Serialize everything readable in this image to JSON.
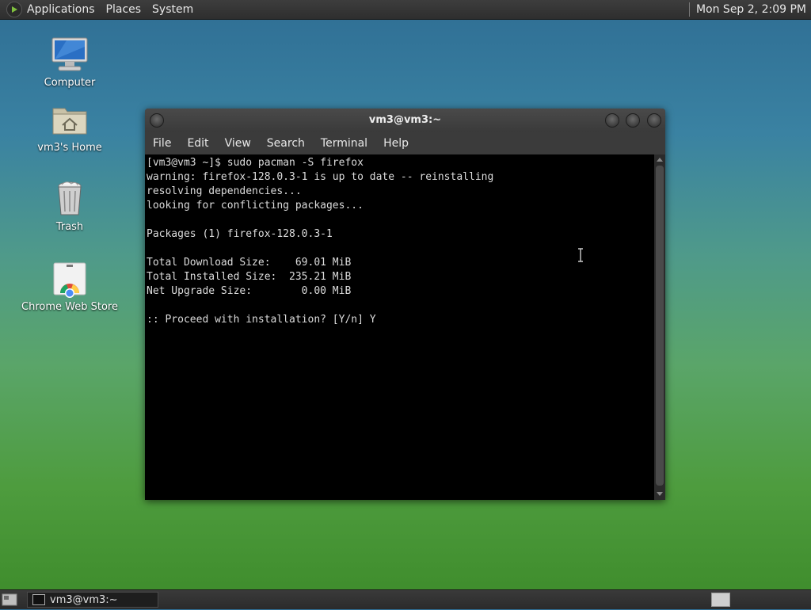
{
  "top_panel": {
    "menus": [
      "Applications",
      "Places",
      "System"
    ],
    "clock": "Mon Sep  2,  2:09 PM"
  },
  "desktop": {
    "icons": [
      {
        "label": "Computer",
        "icon": "computer-icon"
      },
      {
        "label": "vm3's Home",
        "icon": "home-folder-icon"
      },
      {
        "label": "Trash",
        "icon": "trash-icon"
      },
      {
        "label": "Chrome Web Store",
        "icon": "chrome-web-store-icon"
      }
    ]
  },
  "terminal": {
    "title": "vm3@vm3:~",
    "menu": [
      "File",
      "Edit",
      "View",
      "Search",
      "Terminal",
      "Help"
    ],
    "lines": [
      "[vm3@vm3 ~]$ sudo pacman -S firefox",
      "warning: firefox-128.0.3-1 is up to date -- reinstalling",
      "resolving dependencies...",
      "looking for conflicting packages...",
      "",
      "Packages (1) firefox-128.0.3-1",
      "",
      "Total Download Size:    69.01 MiB",
      "Total Installed Size:  235.21 MiB",
      "Net Upgrade Size:        0.00 MiB",
      "",
      ":: Proceed with installation? [Y/n] Y"
    ]
  },
  "taskbar": {
    "window_button": "vm3@vm3:~"
  },
  "colors": {
    "panel": "#2e2e2e",
    "terminal_bg": "#000000",
    "terminal_fg": "#dcdcdc"
  }
}
